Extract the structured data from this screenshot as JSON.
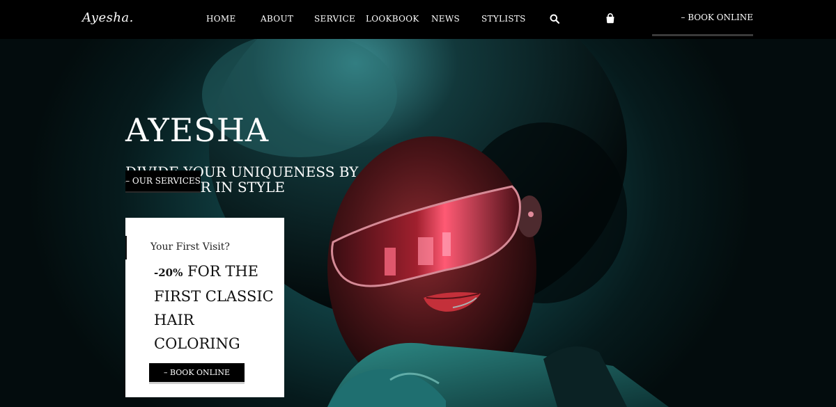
{
  "brand": {
    "logo_text": "Ayesha."
  },
  "nav": {
    "items": [
      "HOME",
      "ABOUT",
      "SERVICE",
      "LOOKBOOK",
      "NEWS",
      "STYLISTS"
    ],
    "search_icon": "search-icon",
    "cart_icon": "shopping-bag-icon",
    "book_label": "– BOOK ONLINE"
  },
  "hero": {
    "title": "AYESHA",
    "subtitle": "DIVIDE YOUR UNIQUENESS BY YOUR HAIR IN STYLE",
    "services_button": "– OUR SERVICES"
  },
  "promo": {
    "question": "Your First Visit?",
    "discount": "-20%",
    "offer_text": "FOR THE FIRST CLASSIC HAIR COLORING",
    "book_button": "– BOOK ONLINE"
  },
  "colors": {
    "nav_background": "#000000",
    "hero_teal": "#1c5f63",
    "accent_red": "#c4303a",
    "card_background": "#ffffff"
  }
}
